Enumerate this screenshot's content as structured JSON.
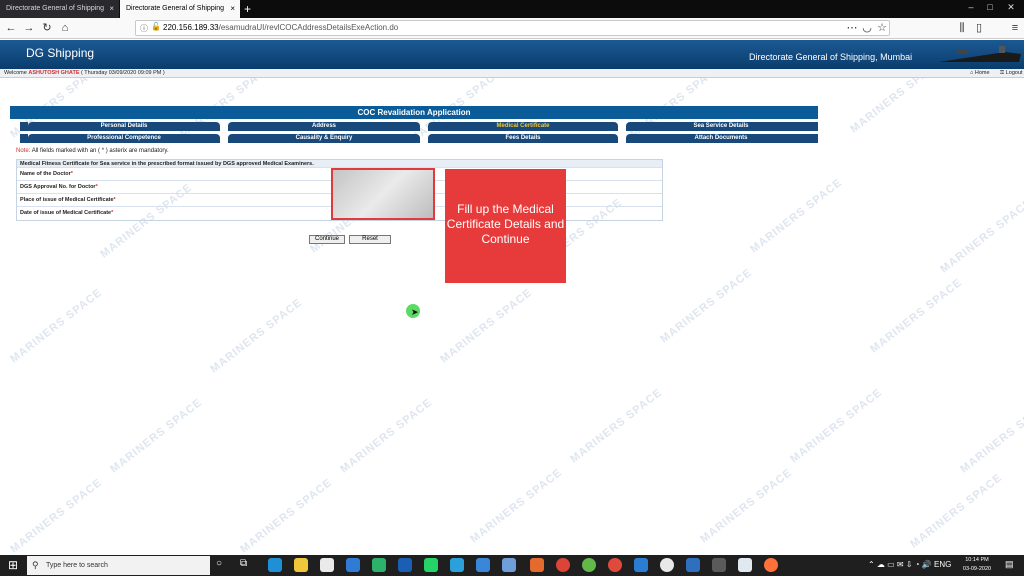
{
  "browser": {
    "tabs": [
      {
        "title": "Directorate General of Shipping",
        "active": false
      },
      {
        "title": "Directorate General of Shipping",
        "active": true
      }
    ],
    "url_host": "220.156.189.33",
    "url_path": "/esamudraUI/revlCOCAddressDetailsExeAction.do",
    "tab_close": "×",
    "new_tab": "+"
  },
  "site": {
    "brand": "DG Shipping",
    "name": "Directorate General of Shipping, Mumbai",
    "welcome_prefix": "Welcome",
    "user": "ASHUTOSH GHATE",
    "datetime": "( Thursday 03/09/2020 09:09 PM )",
    "home": "Home",
    "logout": "Logout"
  },
  "app": {
    "title": "COC Revalidation Application",
    "tabs_row1": [
      "Personal Details",
      "Address",
      "Medical Certificate",
      "Sea Service Details"
    ],
    "tabs_row2": [
      "Professional Competence",
      "Causality & Enquiry",
      "Fees Details",
      "Attach Documents"
    ],
    "active_tab": "Medical Certificate",
    "note_label": "Note",
    "note_text": ": All fields marked with an ( * ) asterix are mandatory.",
    "form_heading": "Medical Fitness Certificate for Sea service in the prescribed format issued by DGS approved Medical Examiners.",
    "fields": [
      {
        "label": "Name of the Doctor"
      },
      {
        "label": "DGS Approval No. for Doctor"
      },
      {
        "label": "Place of issue of Medical Certificate"
      },
      {
        "label": "Date of issue of Medical Certificate"
      }
    ],
    "required_mark": "*",
    "continue_label": "Continue",
    "reset_label": "Reset"
  },
  "overlay": {
    "callout": "Fill up the Medical Certificate Details and Continue"
  },
  "watermark": "MARINERS SPACE",
  "taskbar": {
    "search_placeholder": "Type here to search",
    "lang": "ENG",
    "time": "10:14 PM",
    "date": "03-09-2020"
  },
  "colors": {
    "header": "#0b5b98",
    "tab": "#19497a",
    "active_tab_text": "#f3c73b",
    "callout": "#e73b3b"
  }
}
